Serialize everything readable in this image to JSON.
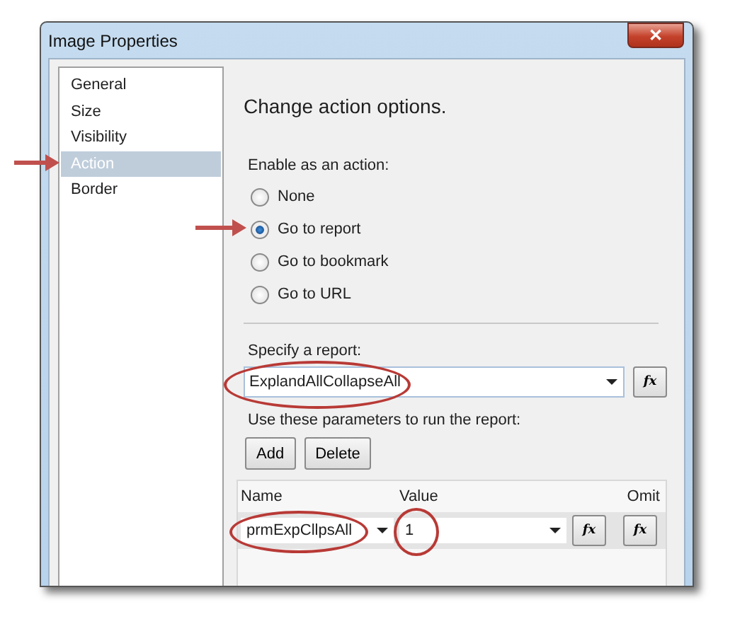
{
  "window": {
    "title": "Image Properties",
    "close": "✕"
  },
  "sidebar": {
    "items": [
      {
        "label": "General",
        "selected": false
      },
      {
        "label": "Size",
        "selected": false
      },
      {
        "label": "Visibility",
        "selected": false
      },
      {
        "label": "Action",
        "selected": true
      },
      {
        "label": "Border",
        "selected": false
      }
    ]
  },
  "content": {
    "heading": "Change action options.",
    "action_label": "Enable as an action:",
    "options": [
      {
        "label": "None",
        "selected": false
      },
      {
        "label": "Go to report",
        "selected": true
      },
      {
        "label": "Go to bookmark",
        "selected": false
      },
      {
        "label": "Go to URL",
        "selected": false
      }
    ],
    "report_label": "Specify a report:",
    "report_value": "ExplandAllCollapseAll",
    "report_fx": "fx",
    "params_label": "Use these parameters to run the report:",
    "buttons": [
      "Add",
      "Delete"
    ],
    "grid": {
      "columns": [
        "Name",
        "Value",
        "Omit"
      ],
      "rows": [
        {
          "name": "prmExpCllpsAll",
          "value": "1",
          "value_fx": "fx",
          "omit_fx": "fx"
        }
      ]
    }
  }
}
